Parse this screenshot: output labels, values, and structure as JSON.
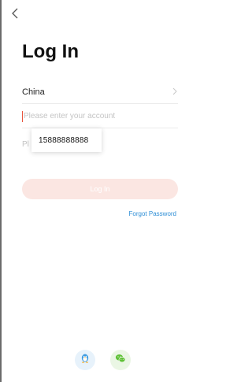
{
  "header": {
    "title": "Log In",
    "back_icon": "chevron-left-icon"
  },
  "form": {
    "country": {
      "label": "China",
      "chevron_icon": "chevron-right-icon"
    },
    "account": {
      "value": "",
      "placeholder": "Please enter your account"
    },
    "password": {
      "value": "",
      "placeholder": "Pl"
    },
    "suggestion": "15888888888",
    "login_label": "Log In",
    "forgot_label": "Forgot Password"
  },
  "social": {
    "qq_icon": "qq-penguin-icon",
    "wechat_icon": "wechat-icon"
  },
  "colors": {
    "accent": "#e8553e",
    "login_disabled_bg": "#fbe6e2",
    "link": "#2f8fd6",
    "qq_blue": "#3b9ae1",
    "wechat_green": "#5ec136"
  }
}
